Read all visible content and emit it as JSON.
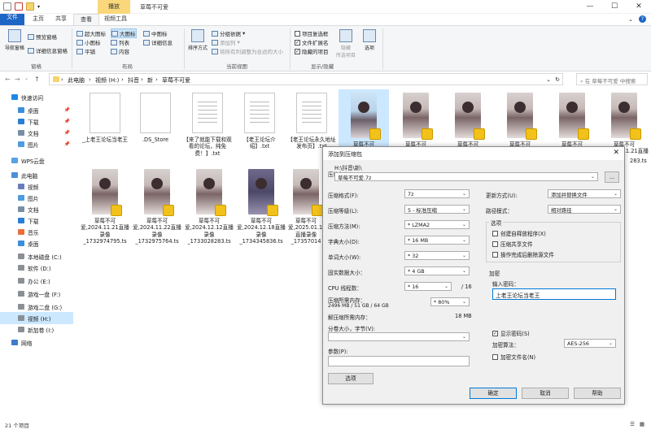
{
  "window": {
    "title": "草莓不可爱",
    "context_tab": "播放",
    "minimize": "—",
    "maximize": "☐",
    "close": "✕"
  },
  "ribbon": {
    "tabs": [
      "文件",
      "主页",
      "共享",
      "查看",
      "视频工具"
    ],
    "pane_group": {
      "label": "窗格",
      "nav_pane": "导航窗格",
      "preview": "预览窗格",
      "details": "详细信息窗格"
    },
    "layout_group": {
      "label": "布局",
      "items": [
        "超大图标",
        "大图标",
        "中图标",
        "小图标",
        "列表",
        "详细信息",
        "平铺",
        "内容"
      ]
    },
    "current_view_group": {
      "label": "当前视图",
      "sort": "排序方式",
      "group_by": "分组依据",
      "add_column": "添加列",
      "fit_columns": "将所有列调整为合适的大小"
    },
    "showhide_group": {
      "label": "显示/隐藏",
      "item_checkboxes": "项目复选框",
      "file_ext": "文件扩展名",
      "hidden_items": "隐藏的项目",
      "hide_selected": "隐藏\n所选项目",
      "options": "选项"
    }
  },
  "address": {
    "path": [
      "此电脑",
      "视频 (H:)",
      "抖音",
      "新",
      "草莓不可爱"
    ],
    "search_placeholder": "在 草莓不可爱 中搜索"
  },
  "nav": {
    "items": [
      {
        "label": "快速访问",
        "icon": "star-icon"
      },
      {
        "label": "桌面",
        "icon": "desktop-icon"
      },
      {
        "label": "下载",
        "icon": "download-icon"
      },
      {
        "label": "文档",
        "icon": "document-icon"
      },
      {
        "label": "图片",
        "icon": "picture-icon"
      },
      {
        "label": "WPS云盘",
        "icon": "cloud-icon"
      },
      {
        "label": "此电脑",
        "icon": "computer-icon"
      },
      {
        "label": "视频",
        "icon": "video-icon"
      },
      {
        "label": "图片",
        "icon": "picture-icon"
      },
      {
        "label": "文档",
        "icon": "document-icon"
      },
      {
        "label": "下载",
        "icon": "download-icon"
      },
      {
        "label": "音乐",
        "icon": "music-icon"
      },
      {
        "label": "桌面",
        "icon": "desktop-icon"
      },
      {
        "label": "本地磁盘 (C:)",
        "icon": "drive-icon"
      },
      {
        "label": "软件 (D:)",
        "icon": "drive-icon"
      },
      {
        "label": "办公 (E:)",
        "icon": "drive-icon"
      },
      {
        "label": "游戏一盘 (F:)",
        "icon": "drive-icon"
      },
      {
        "label": "游戏二盘 (G:)",
        "icon": "drive-icon"
      },
      {
        "label": "视频 (H:)",
        "icon": "drive-icon"
      },
      {
        "label": "新加卷 (I:)",
        "icon": "drive-icon"
      },
      {
        "label": "网络",
        "icon": "network-icon"
      }
    ]
  },
  "files": {
    "row1": [
      "_上老王论坛当老王",
      ".DS_Store",
      "【来了就能下载和观看的论坛，纯免费！】.txt",
      "【老王论坛介绍】.txt",
      "【老王论坛永久地址发布页】.txt",
      "草莓不可爱,2024.11.17直播",
      "草莓不可爱,2024.11.17直播",
      "草莓不可爱,2024.11.20直播",
      "草莓不可爱,2024.11.21直播",
      "草莓不可爱,2024.11.21直播",
      "草莓不可爱,2024.11.21直播"
    ],
    "row2": [
      "草莓不可爱,2024.11.21直播录像_1732974795.ts",
      "草莓不可爱,2024.11.22直播录像_1732975764.ts",
      "草莓不可爱,2024.12.12直播录像_1733028283.ts",
      "草莓不可爱,2024.12.18直播录像_1734345836.ts",
      "草莓不可爱,2025.01.11直播录像_17357014"
    ],
    "partial_right": "283.ts"
  },
  "status": {
    "count": "21 个项目"
  },
  "dialog": {
    "title": "添加到压缩包",
    "archive_label": "压缩包(A):",
    "archive_dir": "H:\\抖音\\新\\",
    "archive_name": "草莓不可爱.7z",
    "browse": "...",
    "format_label": "压缩格式(F):",
    "format_value": "7z",
    "level_label": "压缩等级(L):",
    "level_value": "5 - 标准压缩",
    "method_label": "压缩方法(M):",
    "method_value": "* LZMA2",
    "dict_label": "字典大小(D):",
    "dict_value": "* 16 MB",
    "word_label": "单词大小(W):",
    "word_value": "* 32",
    "solid_label": "固实数据大小：",
    "solid_value": "* 4 GB",
    "cpu_label": "CPU 线程数：",
    "cpu_value": "* 16",
    "cpu_total": "/ 16",
    "mem_label": "压缩所需内存：",
    "mem_detail": "2496 MB / 51 GB / 64 GB",
    "mem_value": "* 80%",
    "decomp_label": "解压缩所需内存：",
    "decomp_value": "18 MB",
    "split_label": "分卷大小，字节(V):",
    "params_label": "参数(P):",
    "options_btn": "选项",
    "update_label": "更新方式(U):",
    "update_value": "添加并替换文件",
    "path_label": "路径模式：",
    "path_value": "相对路径",
    "options_group": "选项",
    "opt_sfx": "创建自释放程序(X)",
    "opt_shared": "压缩共享文件",
    "opt_delete": "操作完成后删除源文件",
    "encrypt_group": "加密",
    "password_label": "输入密码：",
    "password_value": "上老王论坛当老王",
    "show_password": "显示密码(S)",
    "enc_method_label": "加密算法：",
    "enc_method_value": "AES-256",
    "encrypt_names": "加密文件名(N)",
    "ok": "确定",
    "cancel": "取消",
    "help": "帮助"
  }
}
